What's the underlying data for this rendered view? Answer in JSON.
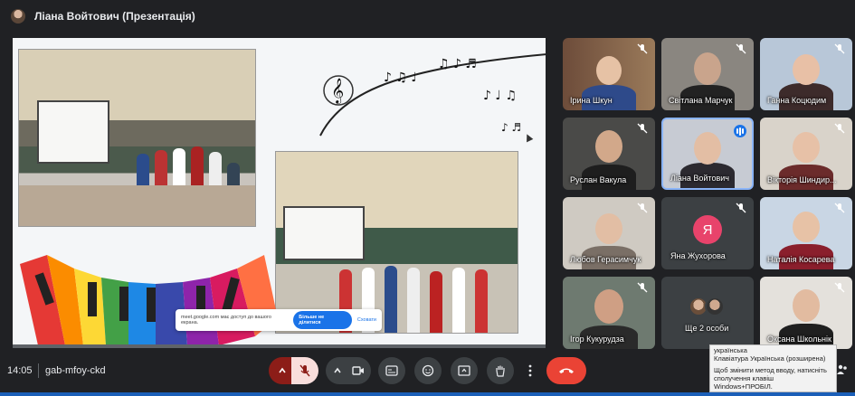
{
  "header": {
    "title": "Ліана Войтович (Презентація)"
  },
  "share_infobar": {
    "text": "meet.google.com має доступ до вашого екрана.",
    "stop_label": "Більше не ділитися",
    "hide_label": "Сховати"
  },
  "participants": [
    {
      "name": "Ірина Шкун",
      "muted": true
    },
    {
      "name": "Світлана Марчук",
      "muted": true
    },
    {
      "name": "Ганна Коцюдим",
      "muted": true
    },
    {
      "name": "Руслан Вакула",
      "muted": true
    },
    {
      "name": "Ліана Войтович",
      "muted": false,
      "speaking": true
    },
    {
      "name": "Вікторія Шиндир...",
      "muted": true
    },
    {
      "name": "Любов Герасимчук",
      "muted": true
    },
    {
      "name": "Яна Жухорова",
      "muted": true,
      "avatar_letter": "Я"
    },
    {
      "name": "Наталія Косарева",
      "muted": true
    },
    {
      "name": "Ігор Кукурудза",
      "muted": true
    },
    {
      "name": "Ще 2 особи",
      "muted": false
    },
    {
      "name": "Оксана Школьнік",
      "muted": true
    }
  ],
  "bottom": {
    "time": "14:05",
    "meeting_code": "gab-mfoy-ckd"
  },
  "icons": [
    "chevron-up-icon",
    "mic-off-icon",
    "chevron-up-icon",
    "camera-icon",
    "captions-icon",
    "emoji-icon",
    "present-icon",
    "raise-hand-icon",
    "more-icon",
    "hang-up-icon"
  ],
  "tooltip": {
    "line1": "українська",
    "line2": "Клавіатура Українська (розширена)",
    "line3": "Щоб змінити метод вводу, натисніть",
    "line4": "сполучення клавіш Windows+ПРОБІЛ."
  },
  "colors": {
    "hangup": "#ea4335",
    "mic_muted_bg": "#f9dedc",
    "accent": "#1a73e8",
    "avatar_ya": "#e8436b"
  }
}
